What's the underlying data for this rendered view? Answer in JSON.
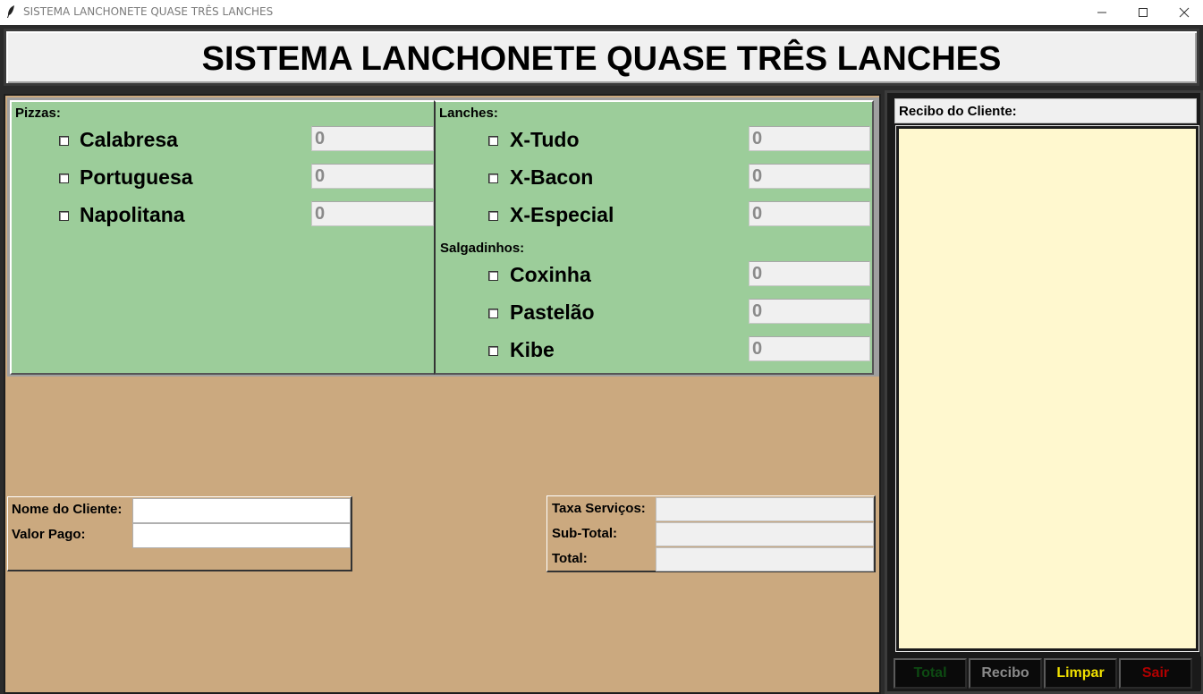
{
  "window": {
    "title": "SISTEMA LANCHONETE QUASE TRÊS LANCHES"
  },
  "header": {
    "title": "SISTEMA LANCHONETE QUASE TRÊS LANCHES"
  },
  "pizzas": {
    "label": "Pizzas:",
    "items": [
      {
        "name": "Calabresa",
        "qty": "0"
      },
      {
        "name": "Portuguesa",
        "qty": "0"
      },
      {
        "name": "Napolitana",
        "qty": "0"
      }
    ]
  },
  "lanches": {
    "label": "Lanches:",
    "items": [
      {
        "name": "X-Tudo",
        "qty": "0"
      },
      {
        "name": "X-Bacon",
        "qty": "0"
      },
      {
        "name": "X-Especial",
        "qty": "0"
      }
    ]
  },
  "salgadinhos": {
    "label": "Salgadinhos:",
    "items": [
      {
        "name": "Coxinha",
        "qty": "0"
      },
      {
        "name": "Pastelão",
        "qty": "0"
      },
      {
        "name": "Kibe",
        "qty": "0"
      }
    ]
  },
  "cliente": {
    "nome_label": "Nome do Cliente:",
    "nome_value": "",
    "valor_label": "Valor Pago:",
    "valor_value": ""
  },
  "totais": {
    "taxa_label": "Taxa Serviços:",
    "subtotal_label": "Sub-Total:",
    "total_label": "Total:"
  },
  "recibo": {
    "label": "Recibo do Cliente:",
    "text": ""
  },
  "buttons": {
    "total": "Total",
    "recibo": "Recibo",
    "limpar": "Limpar",
    "sair": "Sair"
  },
  "colors": {
    "menu_green": "#9ccd9a",
    "body_tan": "#cba97f",
    "receipt_yellow": "#fff8cf",
    "btn_total": "#0d4a12",
    "btn_recibo": "#8a8a8a",
    "btn_limpar": "#f0e000",
    "btn_sair": "#b00000"
  }
}
